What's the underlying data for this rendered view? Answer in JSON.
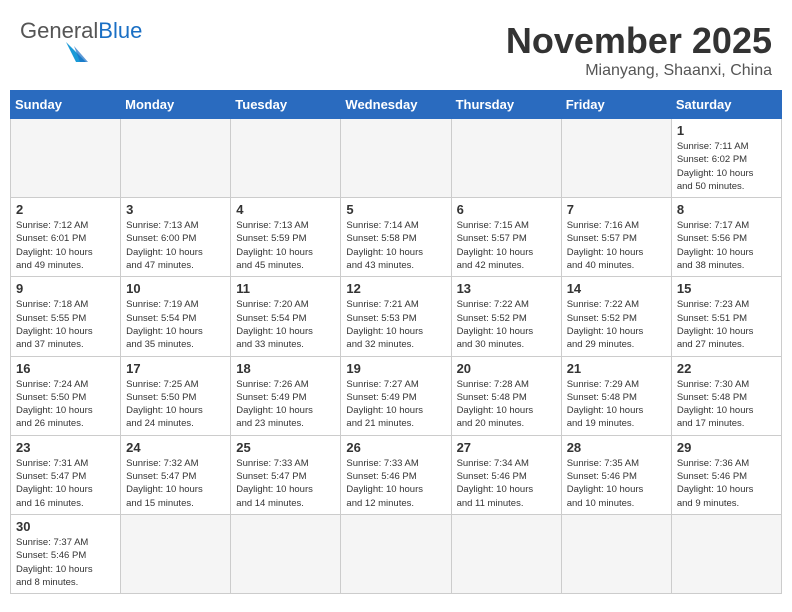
{
  "header": {
    "logo_general": "General",
    "logo_blue": "Blue",
    "month_title": "November 2025",
    "location": "Mianyang, Shaanxi, China"
  },
  "weekdays": [
    "Sunday",
    "Monday",
    "Tuesday",
    "Wednesday",
    "Thursday",
    "Friday",
    "Saturday"
  ],
  "weeks": [
    [
      {
        "day": "",
        "info": ""
      },
      {
        "day": "",
        "info": ""
      },
      {
        "day": "",
        "info": ""
      },
      {
        "day": "",
        "info": ""
      },
      {
        "day": "",
        "info": ""
      },
      {
        "day": "",
        "info": ""
      },
      {
        "day": "1",
        "info": "Sunrise: 7:11 AM\nSunset: 6:02 PM\nDaylight: 10 hours\nand 50 minutes."
      }
    ],
    [
      {
        "day": "2",
        "info": "Sunrise: 7:12 AM\nSunset: 6:01 PM\nDaylight: 10 hours\nand 49 minutes."
      },
      {
        "day": "3",
        "info": "Sunrise: 7:13 AM\nSunset: 6:00 PM\nDaylight: 10 hours\nand 47 minutes."
      },
      {
        "day": "4",
        "info": "Sunrise: 7:13 AM\nSunset: 5:59 PM\nDaylight: 10 hours\nand 45 minutes."
      },
      {
        "day": "5",
        "info": "Sunrise: 7:14 AM\nSunset: 5:58 PM\nDaylight: 10 hours\nand 43 minutes."
      },
      {
        "day": "6",
        "info": "Sunrise: 7:15 AM\nSunset: 5:57 PM\nDaylight: 10 hours\nand 42 minutes."
      },
      {
        "day": "7",
        "info": "Sunrise: 7:16 AM\nSunset: 5:57 PM\nDaylight: 10 hours\nand 40 minutes."
      },
      {
        "day": "8",
        "info": "Sunrise: 7:17 AM\nSunset: 5:56 PM\nDaylight: 10 hours\nand 38 minutes."
      }
    ],
    [
      {
        "day": "9",
        "info": "Sunrise: 7:18 AM\nSunset: 5:55 PM\nDaylight: 10 hours\nand 37 minutes."
      },
      {
        "day": "10",
        "info": "Sunrise: 7:19 AM\nSunset: 5:54 PM\nDaylight: 10 hours\nand 35 minutes."
      },
      {
        "day": "11",
        "info": "Sunrise: 7:20 AM\nSunset: 5:54 PM\nDaylight: 10 hours\nand 33 minutes."
      },
      {
        "day": "12",
        "info": "Sunrise: 7:21 AM\nSunset: 5:53 PM\nDaylight: 10 hours\nand 32 minutes."
      },
      {
        "day": "13",
        "info": "Sunrise: 7:22 AM\nSunset: 5:52 PM\nDaylight: 10 hours\nand 30 minutes."
      },
      {
        "day": "14",
        "info": "Sunrise: 7:22 AM\nSunset: 5:52 PM\nDaylight: 10 hours\nand 29 minutes."
      },
      {
        "day": "15",
        "info": "Sunrise: 7:23 AM\nSunset: 5:51 PM\nDaylight: 10 hours\nand 27 minutes."
      }
    ],
    [
      {
        "day": "16",
        "info": "Sunrise: 7:24 AM\nSunset: 5:50 PM\nDaylight: 10 hours\nand 26 minutes."
      },
      {
        "day": "17",
        "info": "Sunrise: 7:25 AM\nSunset: 5:50 PM\nDaylight: 10 hours\nand 24 minutes."
      },
      {
        "day": "18",
        "info": "Sunrise: 7:26 AM\nSunset: 5:49 PM\nDaylight: 10 hours\nand 23 minutes."
      },
      {
        "day": "19",
        "info": "Sunrise: 7:27 AM\nSunset: 5:49 PM\nDaylight: 10 hours\nand 21 minutes."
      },
      {
        "day": "20",
        "info": "Sunrise: 7:28 AM\nSunset: 5:48 PM\nDaylight: 10 hours\nand 20 minutes."
      },
      {
        "day": "21",
        "info": "Sunrise: 7:29 AM\nSunset: 5:48 PM\nDaylight: 10 hours\nand 19 minutes."
      },
      {
        "day": "22",
        "info": "Sunrise: 7:30 AM\nSunset: 5:48 PM\nDaylight: 10 hours\nand 17 minutes."
      }
    ],
    [
      {
        "day": "23",
        "info": "Sunrise: 7:31 AM\nSunset: 5:47 PM\nDaylight: 10 hours\nand 16 minutes."
      },
      {
        "day": "24",
        "info": "Sunrise: 7:32 AM\nSunset: 5:47 PM\nDaylight: 10 hours\nand 15 minutes."
      },
      {
        "day": "25",
        "info": "Sunrise: 7:33 AM\nSunset: 5:47 PM\nDaylight: 10 hours\nand 14 minutes."
      },
      {
        "day": "26",
        "info": "Sunrise: 7:33 AM\nSunset: 5:46 PM\nDaylight: 10 hours\nand 12 minutes."
      },
      {
        "day": "27",
        "info": "Sunrise: 7:34 AM\nSunset: 5:46 PM\nDaylight: 10 hours\nand 11 minutes."
      },
      {
        "day": "28",
        "info": "Sunrise: 7:35 AM\nSunset: 5:46 PM\nDaylight: 10 hours\nand 10 minutes."
      },
      {
        "day": "29",
        "info": "Sunrise: 7:36 AM\nSunset: 5:46 PM\nDaylight: 10 hours\nand 9 minutes."
      }
    ],
    [
      {
        "day": "30",
        "info": "Sunrise: 7:37 AM\nSunset: 5:46 PM\nDaylight: 10 hours\nand 8 minutes."
      },
      {
        "day": "",
        "info": ""
      },
      {
        "day": "",
        "info": ""
      },
      {
        "day": "",
        "info": ""
      },
      {
        "day": "",
        "info": ""
      },
      {
        "day": "",
        "info": ""
      },
      {
        "day": "",
        "info": ""
      }
    ]
  ]
}
